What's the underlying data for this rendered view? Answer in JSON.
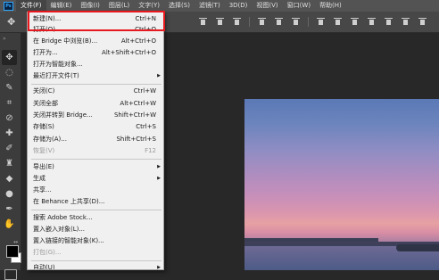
{
  "app": {
    "logo": "Ps"
  },
  "menubar": {
    "items": [
      {
        "label": "文件(F)",
        "active": true
      },
      {
        "label": "编辑(E)"
      },
      {
        "label": "图像(I)"
      },
      {
        "label": "图层(L)"
      },
      {
        "label": "文字(Y)"
      },
      {
        "label": "选择(S)"
      },
      {
        "label": "滤镜(T)"
      },
      {
        "label": "3D(D)"
      },
      {
        "label": "视图(V)"
      },
      {
        "label": "窗口(W)"
      },
      {
        "label": "帮助(H)"
      }
    ]
  },
  "file_menu": {
    "items": [
      {
        "label": "新建(N)...",
        "shortcut": "Ctrl+N"
      },
      {
        "label": "打开(O)...",
        "shortcut": "Ctrl+O"
      },
      {
        "label": "在 Bridge 中浏览(B)...",
        "shortcut": "Alt+Ctrl+O"
      },
      {
        "label": "打开为...",
        "shortcut": "Alt+Shift+Ctrl+O"
      },
      {
        "label": "打开为智能对象..."
      },
      {
        "label": "最近打开文件(T)",
        "submenu": true
      },
      {
        "label": "关闭(C)",
        "shortcut": "Ctrl+W"
      },
      {
        "label": "关闭全部",
        "shortcut": "Alt+Ctrl+W"
      },
      {
        "label": "关闭并转到 Bridge...",
        "shortcut": "Shift+Ctrl+W"
      },
      {
        "label": "存储(S)",
        "shortcut": "Ctrl+S"
      },
      {
        "label": "存储为(A)...",
        "shortcut": "Shift+Ctrl+S"
      },
      {
        "label": "恢复(V)",
        "shortcut": "F12",
        "disabled": true
      },
      {
        "label": "导出(E)",
        "submenu": true
      },
      {
        "label": "生成",
        "submenu": true
      },
      {
        "label": "共享..."
      },
      {
        "label": "在 Behance 上共享(D)..."
      },
      {
        "label": "搜索 Adobe Stock..."
      },
      {
        "label": "置入嵌入对象(L)..."
      },
      {
        "label": "置入链接的智能对象(K)..."
      },
      {
        "label": "打包(G)...",
        "disabled": true
      },
      {
        "label": "自动(U)",
        "submenu": true
      }
    ]
  },
  "colors": {
    "highlight": "#e8191e",
    "foreground_color": "#000000",
    "background_color": "#ffffff"
  },
  "tools": [
    "move-tool-icon",
    "lasso-tool-icon",
    "quick-select-tool-icon",
    "crop-tool-icon",
    "eyedropper-tool-icon",
    "healing-brush-icon",
    "brush-tool-icon",
    "clone-stamp-icon",
    "history-brush-icon",
    "eraser-tool-icon",
    "gradient-tool-icon",
    "blur-tool-icon",
    "dodge-tool-icon",
    "pen-tool-icon",
    "type-tool-icon",
    "path-select-icon",
    "shape-tool-icon",
    "hand-tool-icon",
    "zoom-tool-icon",
    "more-tools-icon"
  ]
}
